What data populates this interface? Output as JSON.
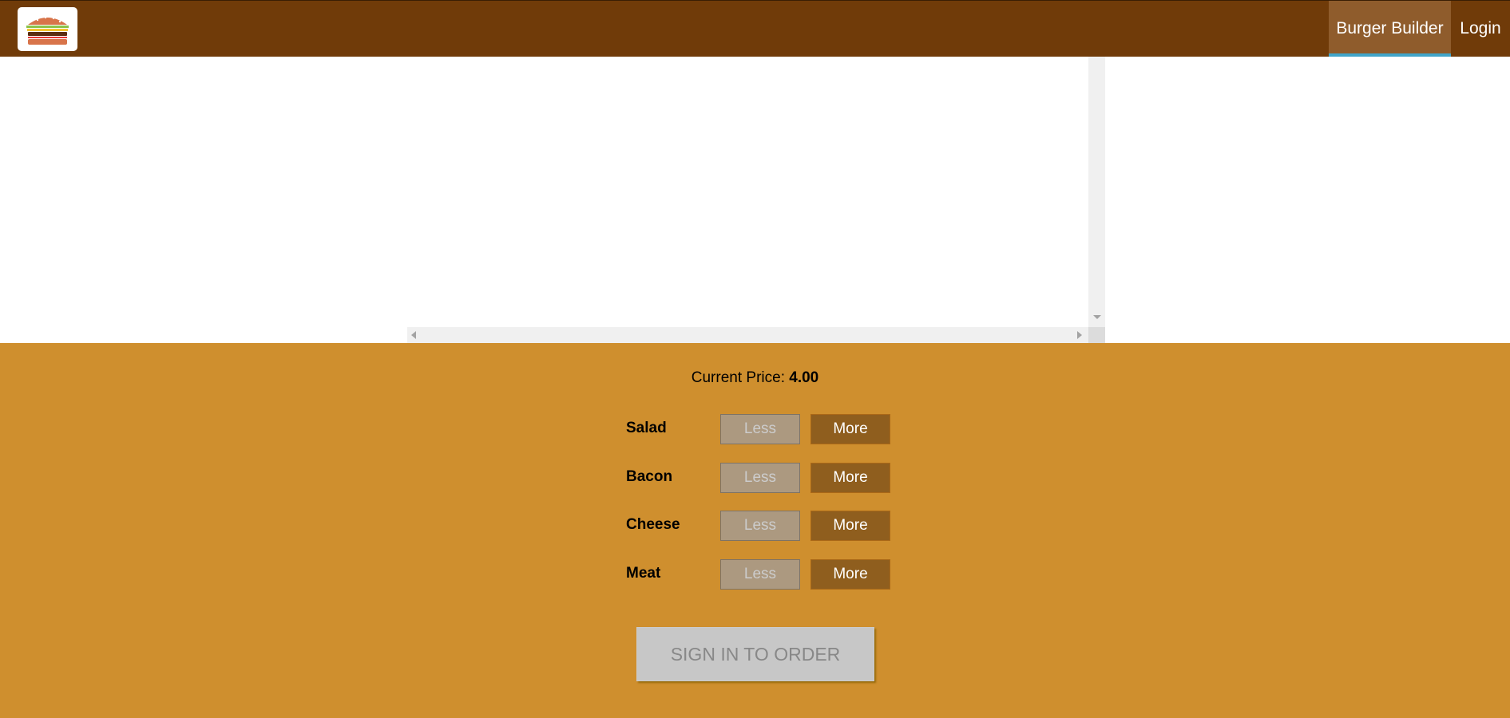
{
  "toolbar": {
    "logo_alt": "burger-logo",
    "nav": {
      "burger_builder": "Burger Builder",
      "login": "Login"
    },
    "colors": {
      "background": "#703b09",
      "active_background": "#8f5c2c",
      "active_indicator": "#40a4c8"
    }
  },
  "controls": {
    "price_label": "Current Price:",
    "price_value": "4.00",
    "ingredients": [
      {
        "label": "Salad",
        "less": "Less",
        "more": "More"
      },
      {
        "label": "Bacon",
        "less": "Less",
        "more": "More"
      },
      {
        "label": "Cheese",
        "less": "Less",
        "more": "More"
      },
      {
        "label": "Meat",
        "less": "Less",
        "more": "More"
      }
    ],
    "order_button": "SIGN IN TO ORDER",
    "colors": {
      "background": "#cf8f2e",
      "more_button": "#8f5e1e",
      "less_button_disabled": "#ac9980"
    }
  }
}
